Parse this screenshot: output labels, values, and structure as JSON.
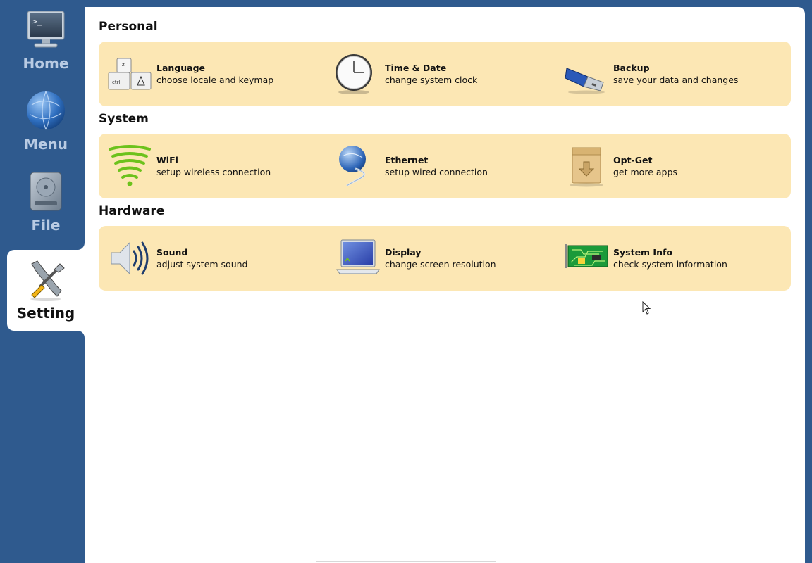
{
  "sidebar": {
    "items": [
      {
        "label": "Home",
        "icon": "monitor-icon",
        "active": false
      },
      {
        "label": "Menu",
        "icon": "globe-icon",
        "active": false
      },
      {
        "label": "File",
        "icon": "hard-drive-icon",
        "active": false
      },
      {
        "label": "Setting",
        "icon": "tools-icon",
        "active": true
      }
    ]
  },
  "sections": [
    {
      "title": "Personal",
      "tiles": [
        {
          "title": "Language",
          "desc": "choose locale and keymap",
          "icon": "keyboard-icon"
        },
        {
          "title": "Time & Date",
          "desc": "change system clock",
          "icon": "clock-icon"
        },
        {
          "title": "Backup",
          "desc": "save your data and changes",
          "icon": "usb-drive-icon"
        }
      ]
    },
    {
      "title": "System",
      "tiles": [
        {
          "title": "WiFi",
          "desc": "setup wireless connection",
          "icon": "wifi-icon"
        },
        {
          "title": "Ethernet",
          "desc": "setup wired connection",
          "icon": "ethernet-icon"
        },
        {
          "title": "Opt-Get",
          "desc": "get more apps",
          "icon": "package-icon"
        }
      ]
    },
    {
      "title": "Hardware",
      "tiles": [
        {
          "title": "Sound",
          "desc": "adjust system sound",
          "icon": "speaker-icon"
        },
        {
          "title": "Display",
          "desc": "change screen resolution",
          "icon": "laptop-icon"
        },
        {
          "title": "System Info",
          "desc": "check system information",
          "icon": "circuit-board-icon"
        }
      ]
    }
  ],
  "colors": {
    "background": "#2f5a8e",
    "panel": "#fce7b4",
    "nav_label": "#b9cbe3"
  }
}
